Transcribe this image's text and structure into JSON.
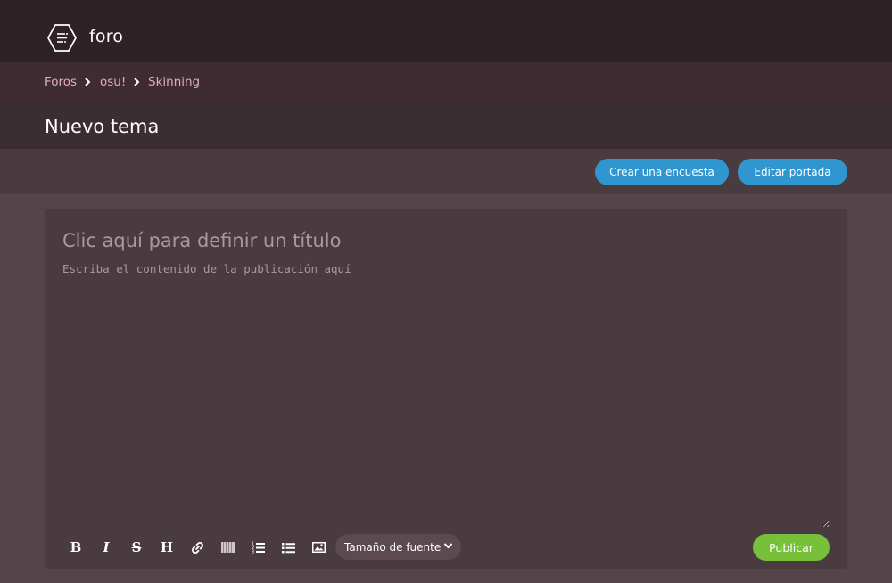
{
  "header": {
    "title": "foro",
    "logo_icon": "forum-logo-icon"
  },
  "breadcrumb": {
    "items": [
      "Foros",
      "osu!",
      "Skinning"
    ],
    "separator_icon": "chevron-right-icon"
  },
  "page": {
    "title": "Nuevo tema"
  },
  "actions": {
    "poll_button": "Crear una encuesta",
    "cover_button": "Editar portada"
  },
  "editor": {
    "title_placeholder": "Clic aquí para definir un título",
    "body_placeholder": "Escriba el contenido de la publicación aquí",
    "toolbar": {
      "bold": "B",
      "italic": "I",
      "strike": "S",
      "heading": "H",
      "link_icon": "link-icon",
      "spoiler_icon": "spoiler-box-icon",
      "ordered_list_icon": "ordered-list-icon",
      "unordered_list_icon": "unordered-list-icon",
      "image_icon": "image-icon",
      "font_size_label": "Tamaño de fuente"
    },
    "publish_button": "Publicar"
  },
  "colors": {
    "header_bg": "#2e2226",
    "breadcrumb_bg": "#3f2c33",
    "breadcrumb_link": "#e6a9c3",
    "accent_blue": "#3096d0",
    "publish_green": "#78c03a",
    "page_bg": "#554449"
  }
}
